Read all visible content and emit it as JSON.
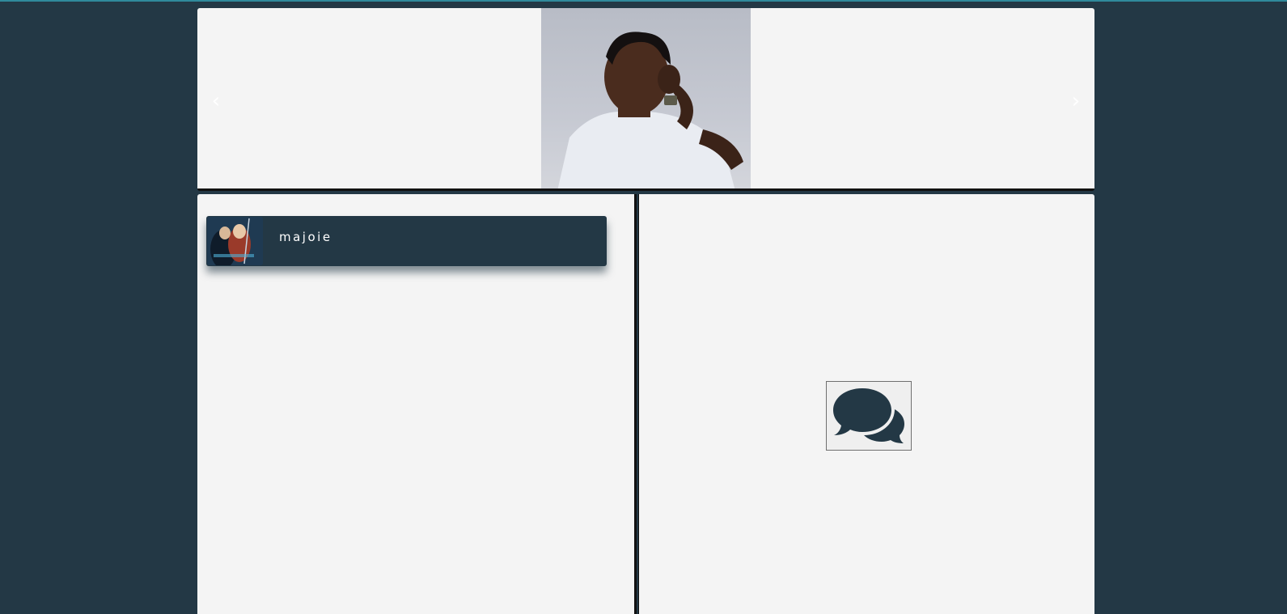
{
  "carousel": {
    "prev_label": "‹",
    "next_label": "›",
    "slide_image": "man-portrait-photo"
  },
  "contacts": [
    {
      "name": "majoie",
      "avatar": "anime-avatar-image"
    }
  ],
  "chat_panel": {
    "icon": "comments-icon"
  },
  "colors": {
    "background": "#233845",
    "panel": "#f4f4f4",
    "card": "#233845",
    "accent_rule": "#2f8a9c"
  }
}
